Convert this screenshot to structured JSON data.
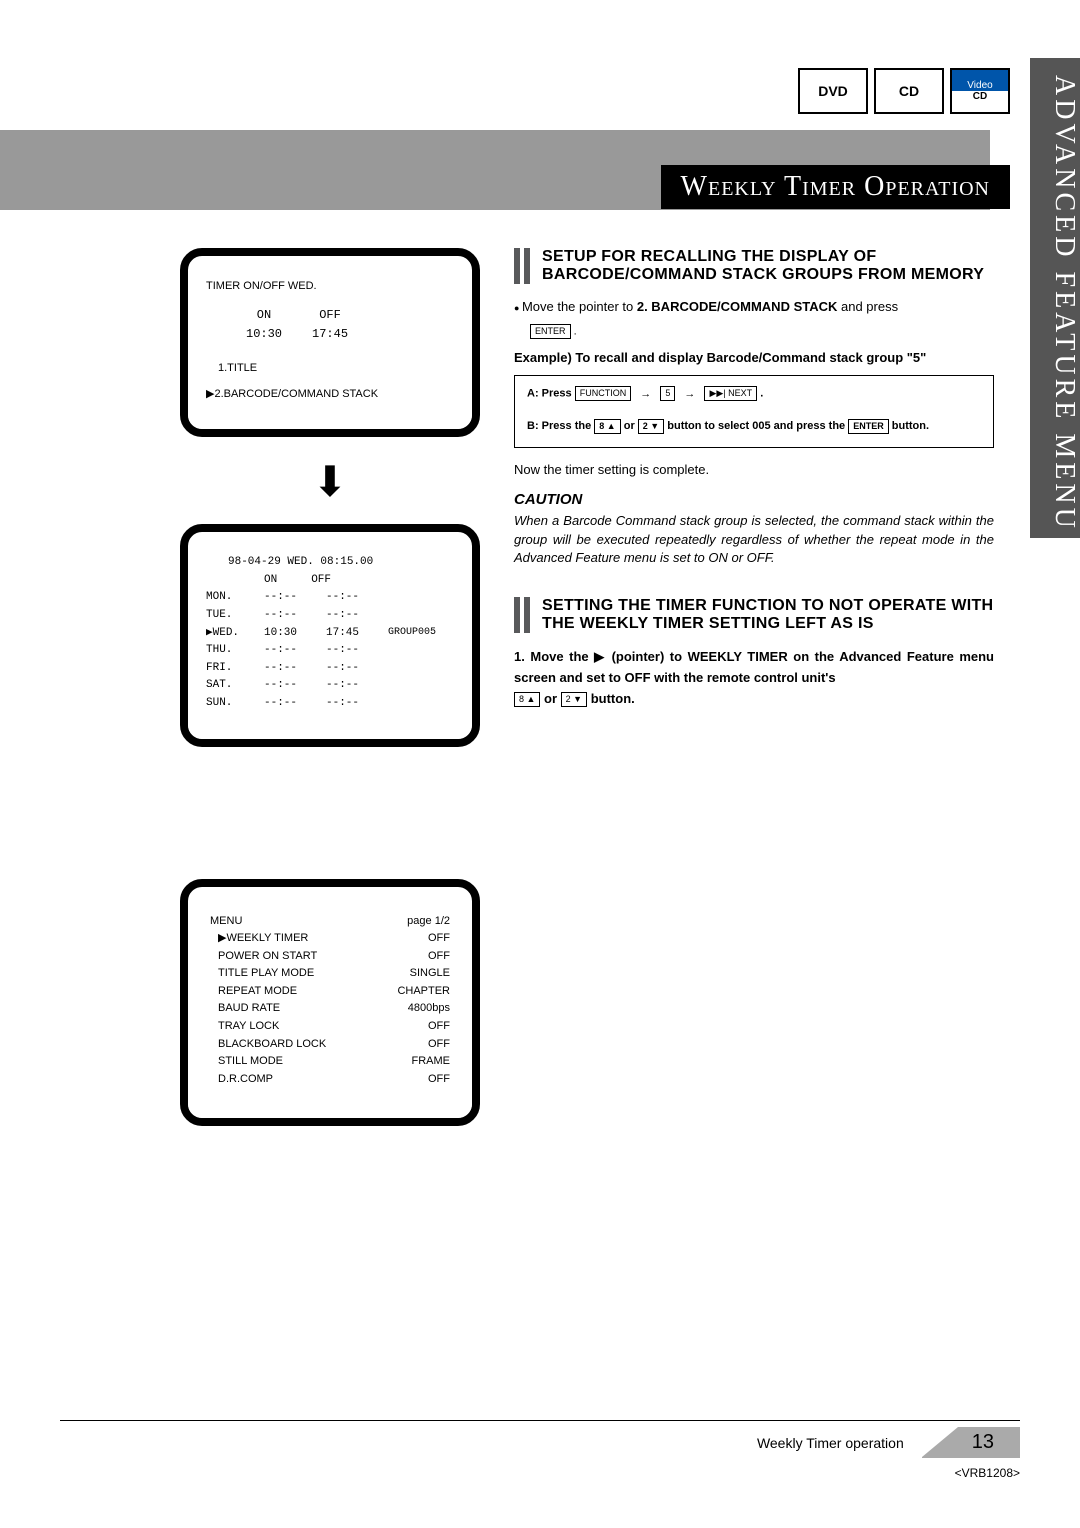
{
  "sideTab": "ADVANCED FEATURE MENU",
  "logos": {
    "dvd": "DVD",
    "cd": "CD",
    "vcdTop": "Video",
    "vcdBot": "CD"
  },
  "titleBar": "Weekly Timer Operation",
  "screen1": {
    "l1": "TIMER  ON/OFF      WED.",
    "onLabel": "ON",
    "offLabel": "OFF",
    "onTime": "10:30",
    "offTime": "17:45",
    "titleLine": "1.TITLE",
    "barcodeLine": "▶2.BARCODE/COMMAND STACK"
  },
  "screen2": {
    "header": "98-04-29  WED.   08:15.00",
    "onLabel": "ON",
    "offLabel": "OFF",
    "rows": [
      {
        "day": "MON.",
        "on": "--:--",
        "off": "--:--",
        "grp": ""
      },
      {
        "day": "TUE.",
        "on": "--:--",
        "off": "--:--",
        "grp": ""
      },
      {
        "day": "▶WED.",
        "on": "10:30",
        "off": "17:45",
        "grp": "GROUP005"
      },
      {
        "day": "THU.",
        "on": "--:--",
        "off": "--:--",
        "grp": ""
      },
      {
        "day": "FRI.",
        "on": "--:--",
        "off": "--:--",
        "grp": ""
      },
      {
        "day": "SAT.",
        "on": "--:--",
        "off": "--:--",
        "grp": ""
      },
      {
        "day": "SUN.",
        "on": "--:--",
        "off": "--:--",
        "grp": ""
      }
    ]
  },
  "screen3": {
    "menuLabel": "MENU",
    "pageLabel": "page 1/2",
    "items": [
      {
        "name": "▶WEEKLY TIMER",
        "val": "OFF"
      },
      {
        "name": "POWER ON START",
        "val": "OFF"
      },
      {
        "name": "TITLE PLAY MODE",
        "val": "SINGLE"
      },
      {
        "name": "REPEAT MODE",
        "val": "CHAPTER"
      },
      {
        "name": "BAUD RATE",
        "val": "4800bps"
      },
      {
        "name": "TRAY LOCK",
        "val": "OFF"
      },
      {
        "name": "BLACKBOARD LOCK",
        "val": "OFF"
      },
      {
        "name": "STILL MODE",
        "val": "FRAME"
      },
      {
        "name": "D.R.COMP",
        "val": "OFF"
      }
    ]
  },
  "sec1Title": "SETUP FOR RECALLING THE DISPLAY OF BARCODE/COMMAND STACK GROUPS FROM MEMORY",
  "instr1a": "Move the pointer to ",
  "instr1b": "2. BARCODE/COMMAND STACK",
  "instr1c": " and press",
  "btnEnter": "ENTER",
  "example": "Example) To recall and display Barcode/Command stack group \"5\"",
  "boxA1": "A: Press ",
  "btnFunction": "FUNCTION",
  "arrow": "→",
  "box5": "5",
  "btnNext": "▶▶| NEXT",
  "dot": ".",
  "boxB1": "B: Press the ",
  "btnUp": "8 ▲",
  "orWord": " or ",
  "btnDown": "2 ▼",
  "boxB2": " button to select 005 and press the ",
  "boxB3": " button.",
  "nowComplete": "Now the timer setting is complete.",
  "cautionHead": "CAUTION",
  "cautionBody": "When a Barcode Command stack group is selected, the command stack within the group will be executed repeatedly regardless of whether the repeat mode in the Advanced Feature menu is set to ON or OFF.",
  "sec2Title": "SETTING THE TIMER FUNCTION TO NOT OPERATE WITH THE WEEKLY TIMER SETTING LEFT AS IS",
  "step1a": "Move the ▶ (pointer) to WEEKLY TIMER on the Advanced Feature menu screen and set to OFF with the remote control unit's",
  "step1b": " button.",
  "footerLabel": "Weekly Timer operation",
  "pageNum": "13",
  "docId": "<VRB1208>"
}
